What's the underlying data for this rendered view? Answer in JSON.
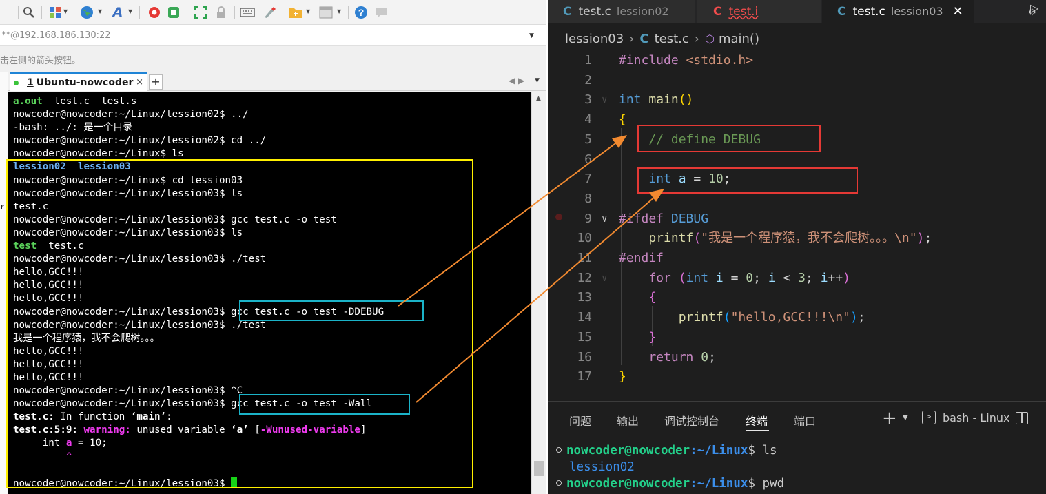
{
  "terminal_app": {
    "toolbar_icons": [
      "search-icon",
      "session-manager-icon",
      "globe-icon",
      "font-icon",
      "xftp-icon",
      "xmanager-icon",
      "fullscreen-icon",
      "lock-icon",
      "keyboard-icon",
      "highlight-icon",
      "new-folder-icon",
      "layout-icon",
      "help-icon",
      "chat-icon"
    ],
    "address": "**@192.168.186.130:22",
    "hint": "击左侧的箭头按钮。",
    "tab": {
      "number": "1",
      "title": "Ubuntu-nowcoder",
      "close": "×",
      "add": "+"
    },
    "stub_char": "r",
    "lines": [
      [
        {
          "t": "a.out",
          "c": "gb"
        },
        {
          "t": "  test.c  test.s"
        }
      ],
      [
        {
          "t": "nowcoder@nowcoder:~/Linux/lession02$ ../"
        }
      ],
      [
        {
          "t": "-bash: ../: 是一个目录"
        }
      ],
      [
        {
          "t": "nowcoder@nowcoder:~/Linux/lession02$ cd ../"
        }
      ],
      [
        {
          "t": "nowcoder@nowcoder:~/Linux$ ls"
        }
      ],
      [
        {
          "t": "lession02",
          "c": "bb"
        },
        {
          "t": "  "
        },
        {
          "t": "lession03",
          "c": "bb"
        }
      ],
      [
        {
          "t": "nowcoder@nowcoder:~/Linux$ cd lession03"
        }
      ],
      [
        {
          "t": "nowcoder@nowcoder:~/Linux/lession03$ ls"
        }
      ],
      [
        {
          "t": "test.c"
        }
      ],
      [
        {
          "t": "nowcoder@nowcoder:~/Linux/lession03$ gcc test.c -o test"
        }
      ],
      [
        {
          "t": "nowcoder@nowcoder:~/Linux/lession03$ ls"
        }
      ],
      [
        {
          "t": "test",
          "c": "gb"
        },
        {
          "t": "  test.c"
        }
      ],
      [
        {
          "t": "nowcoder@nowcoder:~/Linux/lession03$ ./test"
        }
      ],
      [
        {
          "t": "hello,GCC!!!"
        }
      ],
      [
        {
          "t": "hello,GCC!!!"
        }
      ],
      [
        {
          "t": "hello,GCC!!!"
        }
      ],
      [
        {
          "t": "nowcoder@nowcoder:~/Linux/lession03$ gcc test.c -o test -DDEBUG"
        }
      ],
      [
        {
          "t": "nowcoder@nowcoder:~/Linux/lession03$ ./test"
        }
      ],
      [
        {
          "t": "我是一个程序猿，我不会爬树。。。"
        }
      ],
      [
        {
          "t": "hello,GCC!!!"
        }
      ],
      [
        {
          "t": "hello,GCC!!!"
        }
      ],
      [
        {
          "t": "hello,GCC!!!"
        }
      ],
      [
        {
          "t": "nowcoder@nowcoder:~/Linux/lession03$ ^C"
        }
      ],
      [
        {
          "t": "nowcoder@nowcoder:~/Linux/lession03$ gcc test.c -o test -Wall"
        }
      ],
      [
        {
          "t": "test.c:",
          "c": "wb"
        },
        {
          "t": " In function "
        },
        {
          "t": "‘main’",
          "c": "wb"
        },
        {
          "t": ":"
        }
      ],
      [
        {
          "t": "test.c:5:9: ",
          "c": "wb"
        },
        {
          "t": "warning: ",
          "c": "mb"
        },
        {
          "t": "unused variable "
        },
        {
          "t": "‘a’",
          "c": "wb"
        },
        {
          "t": " ["
        },
        {
          "t": "-Wunused-variable",
          "c": "mb"
        },
        {
          "t": "]"
        }
      ],
      [
        {
          "t": "     int "
        },
        {
          "t": "a",
          "c": "mb"
        },
        {
          "t": " = 10;"
        }
      ],
      [
        {
          "t": "         ^",
          "c": "m"
        }
      ],
      [
        {
          "t": ""
        }
      ],
      [
        {
          "t": "nowcoder@nowcoder:~/Linux/lession03$ "
        },
        {
          "cursor": true
        }
      ]
    ]
  },
  "vscode": {
    "tabs": [
      {
        "icon": "C",
        "name": "test.c",
        "desc": "lession02"
      },
      {
        "icon": "C",
        "name": "test.i",
        "desc": ""
      },
      {
        "icon": "C",
        "name": "test.c",
        "desc": "lession03",
        "close": "✕"
      }
    ],
    "breadcrumb": {
      "folder": "lession03",
      "file_icon": "C",
      "file": "test.c",
      "symbol": "main()"
    },
    "code_lines": [
      {
        "n": "1",
        "fold": "",
        "toks": [
          {
            "t": "#include ",
            "c": "inc"
          },
          {
            "t": "<stdio.h>",
            "c": "hdr"
          }
        ]
      },
      {
        "n": "2",
        "fold": "",
        "toks": []
      },
      {
        "n": "3",
        "fold": "v",
        "faint": true,
        "toks": [
          {
            "t": "int",
            "c": "kw"
          },
          {
            "t": " "
          },
          {
            "t": "main",
            "c": "fn"
          },
          {
            "t": "()",
            "c": "br1"
          }
        ]
      },
      {
        "n": "4",
        "fold": "",
        "toks": [
          {
            "t": "{",
            "c": "br1"
          }
        ]
      },
      {
        "n": "5",
        "fold": "",
        "toks": [
          {
            "t": "    "
          },
          {
            "t": "// define DEBUG",
            "c": "cmt"
          }
        ]
      },
      {
        "n": "6",
        "fold": "",
        "toks": []
      },
      {
        "n": "7",
        "fold": "",
        "toks": [
          {
            "t": "    "
          },
          {
            "t": "int",
            "c": "kw"
          },
          {
            "t": " "
          },
          {
            "t": "a",
            "c": "var"
          },
          {
            "t": " = "
          },
          {
            "t": "10",
            "c": "num"
          },
          {
            "t": ";"
          }
        ]
      },
      {
        "n": "8",
        "fold": "",
        "toks": []
      },
      {
        "n": "9",
        "fold": "v",
        "toks": [
          {
            "t": "#ifdef ",
            "c": "inc"
          },
          {
            "t": "DEBUG",
            "c": "ident"
          }
        ]
      },
      {
        "n": "10",
        "fold": "",
        "toks": [
          {
            "t": "    "
          },
          {
            "t": "printf",
            "c": "fn"
          },
          {
            "t": "(",
            "c": "br2"
          },
          {
            "t": "\"我是一个程序猿，我不会爬树。。。\\n\"",
            "c": "str"
          },
          {
            "t": ")",
            "c": "br2"
          },
          {
            "t": ";"
          }
        ]
      },
      {
        "n": "11",
        "fold": "",
        "toks": [
          {
            "t": "#endif",
            "c": "inc"
          }
        ]
      },
      {
        "n": "12",
        "fold": "v",
        "faint": true,
        "toks": [
          {
            "t": "    "
          },
          {
            "t": "for",
            "c": "cf"
          },
          {
            "t": " "
          },
          {
            "t": "(",
            "c": "br2"
          },
          {
            "t": "int",
            "c": "kw"
          },
          {
            "t": " "
          },
          {
            "t": "i",
            "c": "var"
          },
          {
            "t": " = "
          },
          {
            "t": "0",
            "c": "num"
          },
          {
            "t": "; "
          },
          {
            "t": "i",
            "c": "var"
          },
          {
            "t": " < "
          },
          {
            "t": "3",
            "c": "num"
          },
          {
            "t": "; "
          },
          {
            "t": "i",
            "c": "var"
          },
          {
            "t": "++"
          },
          {
            "t": ")",
            "c": "br2"
          }
        ]
      },
      {
        "n": "13",
        "fold": "",
        "toks": [
          {
            "t": "    "
          },
          {
            "t": "{",
            "c": "br2"
          }
        ]
      },
      {
        "n": "14",
        "fold": "",
        "toks": [
          {
            "t": "        "
          },
          {
            "t": "printf",
            "c": "fn"
          },
          {
            "t": "(",
            "c": "br3"
          },
          {
            "t": "\"hello,GCC!!!\\n\"",
            "c": "str"
          },
          {
            "t": ")",
            "c": "br3"
          },
          {
            "t": ";"
          }
        ]
      },
      {
        "n": "15",
        "fold": "",
        "toks": [
          {
            "t": "    "
          },
          {
            "t": "}",
            "c": "br2"
          }
        ]
      },
      {
        "n": "16",
        "fold": "",
        "toks": [
          {
            "t": "    "
          },
          {
            "t": "return",
            "c": "cf"
          },
          {
            "t": " "
          },
          {
            "t": "0",
            "c": "num"
          },
          {
            "t": ";"
          }
        ]
      },
      {
        "n": "17",
        "fold": "",
        "toks": [
          {
            "t": "}",
            "c": "br1"
          }
        ]
      }
    ],
    "panel": {
      "tabs": [
        "问题",
        "输出",
        "调试控制台",
        "终端",
        "端口"
      ],
      "active": "终端",
      "add": "+",
      "shell": "bash - Linux"
    },
    "terminal_lines": [
      {
        "user": "nowcoder@nowcoder",
        "path": ":~/Linux",
        "prompt": "$ ",
        "cmd": "ls"
      },
      {
        "out": "lession02"
      },
      {
        "user": "nowcoder@nowcoder",
        "path": ":~/Linux",
        "prompt": "$ ",
        "cmd": "pwd"
      }
    ]
  },
  "colors": {
    "annotation_yellow": "#fff000",
    "annotation_cyan": "#1bb3c8",
    "annotation_red": "#e53935",
    "annotation_arrow": "#f28a30"
  }
}
